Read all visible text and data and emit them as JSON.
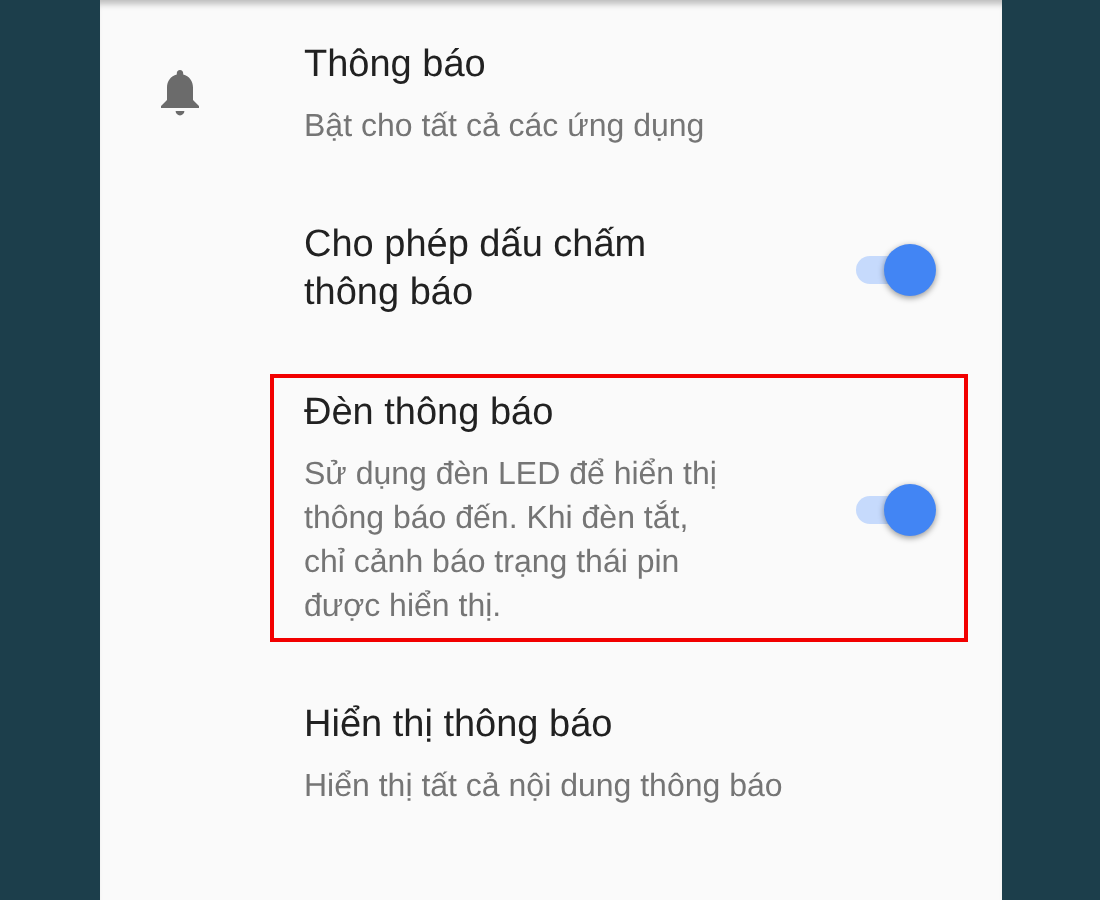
{
  "settings": [
    {
      "kind": "bell",
      "title": "Thông báo",
      "subtitle": "Bật cho tất cả các ứng dụng",
      "highlighted": false
    },
    {
      "kind": "switch",
      "title": "Cho phép dấu chấm thông báo",
      "on": true,
      "highlighted": false
    },
    {
      "kind": "switch",
      "title": "Đèn thông báo",
      "subtitle": "Sử dụng đèn LED để hiển thị thông báo đến. Khi đèn tắt, chỉ cảnh báo trạng thái pin được hiển thị.",
      "on": true,
      "highlighted": true
    },
    {
      "kind": "plain",
      "title": "Hiển thị thông báo",
      "subtitle": "Hiển thị tất cả nội dung thông báo",
      "highlighted": false
    }
  ]
}
